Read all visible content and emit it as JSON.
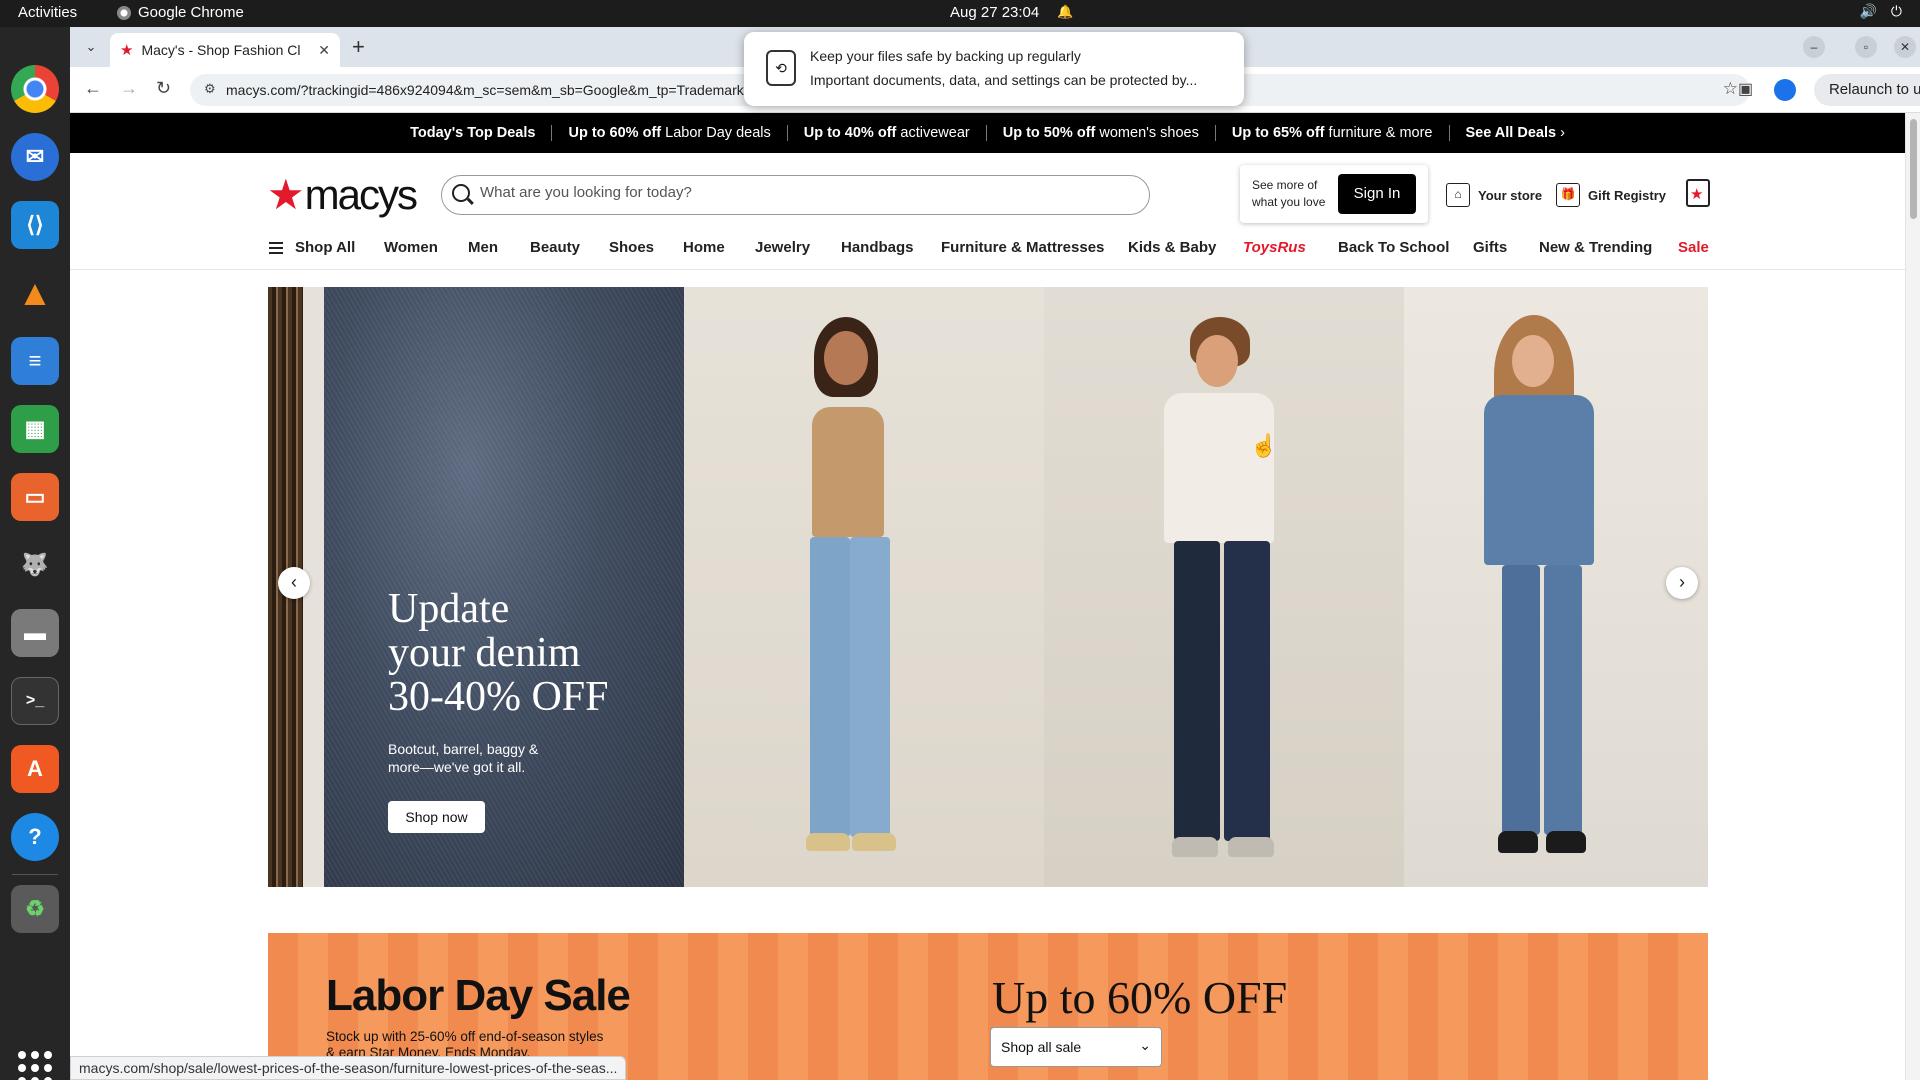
{
  "topbar": {
    "activities": "Activities",
    "app_name": "Google Chrome",
    "clock": "Aug 27  23:04"
  },
  "dock": {
    "items": [
      "chrome-icon",
      "thunderbird-icon",
      "vscode-icon",
      "vlc-icon",
      "writer-icon",
      "calc-icon",
      "impress-icon",
      "gimp-icon",
      "files-icon",
      "terminal-icon",
      "app-center-icon",
      "help-icon",
      "trash-icon"
    ]
  },
  "browser": {
    "tab_title": "Macy's - Shop Fashion Cl",
    "url": "macys.com/?trackingid=486x924094&m_sc=sem&m_sb=Google&m_tp=Trademark...GL_Trademark_Online_Exact&m_pi=go_cmp-100911309...",
    "relaunch_label": "Relaunch to update",
    "status_url": "macys.com/shop/sale/lowest-prices-of-the-season/furniture-lowest-prices-of-the-seas..."
  },
  "notification": {
    "title": "Keep your files safe by backing up regularly",
    "body": "Important documents, data, and settings can be protected by..."
  },
  "deals_bar": {
    "items": [
      {
        "bold": "Today's Top Deals",
        "rest": ""
      },
      {
        "bold": "Up to 60% off",
        "rest": " Labor Day deals"
      },
      {
        "bold": "Up to 40% off",
        "rest": " activewear"
      },
      {
        "bold": "Up to 50% off",
        "rest": " women's shoes"
      },
      {
        "bold": "Up to 65% off",
        "rest": " furniture & more"
      },
      {
        "bold": "See All Deals",
        "rest": " ›"
      }
    ]
  },
  "header": {
    "logo_text": "macys",
    "search_placeholder": "What are you looking for today?",
    "see_more": "See more of what you love",
    "sign_in": "Sign In",
    "your_store": "Your store",
    "gift_registry": "Gift Registry"
  },
  "nav": {
    "shop_all": "Shop All",
    "items": [
      "Women",
      "Men",
      "Beauty",
      "Shoes",
      "Home",
      "Jewelry",
      "Handbags",
      "Furniture & Mattresses",
      "Kids & Baby",
      "ToysRus",
      "Back To School",
      "Gifts",
      "New & Trending",
      "Sale"
    ]
  },
  "hero": {
    "headline_1": "Update",
    "headline_2": "your denim",
    "headline_3": "30-40% OFF",
    "sub": "Bootcut, barrel, baggy & more—we've got it all.",
    "cta": "Shop now",
    "slide_count": 4,
    "active_slide": 1
  },
  "labor_day": {
    "heading": "Labor Day Sale",
    "sub_1": "Stock up with 25-60% off end-of-season styles",
    "sub_2": "& earn Star Money. Ends Monday.",
    "big": "Up to 60% OFF",
    "select_label": "Shop all sale"
  },
  "colors": {
    "brand_red": "#e21a2c",
    "deals_bg": "#000000",
    "labor_orange": "#f08a4e"
  }
}
